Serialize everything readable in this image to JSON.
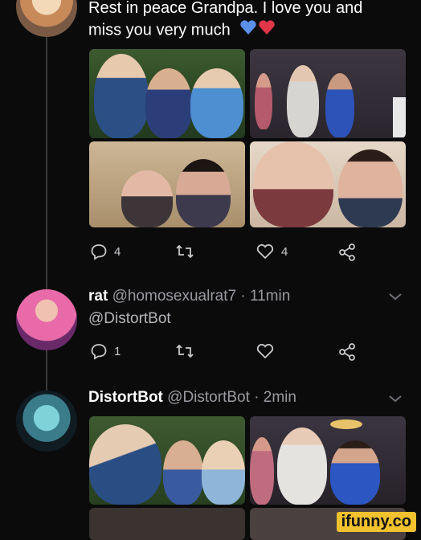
{
  "post1": {
    "text_line1": "Rest in peace Grandpa. I love you and",
    "text_line2": "miss you very much",
    "reply_count": "4",
    "like_count": "4"
  },
  "reply1": {
    "name": "rat",
    "handle": "@homosexualrat7",
    "time": "· 11min",
    "mention": "@DistortBot",
    "reply_count": "1"
  },
  "reply2": {
    "name": "DistortBot",
    "handle": "@DistortBot",
    "time": "· 2min"
  },
  "watermark": "ifunny.co",
  "icons": {
    "reply": "speech-bubble-icon",
    "retweet": "retweet-icon",
    "like": "heart-outline-icon",
    "share": "share-icon",
    "chevron": "chevron-down-icon"
  },
  "colors": {
    "blue_heart": "#5b8fe8",
    "red_heart": "#e0364a",
    "link_gray": "#9a9aa0"
  }
}
